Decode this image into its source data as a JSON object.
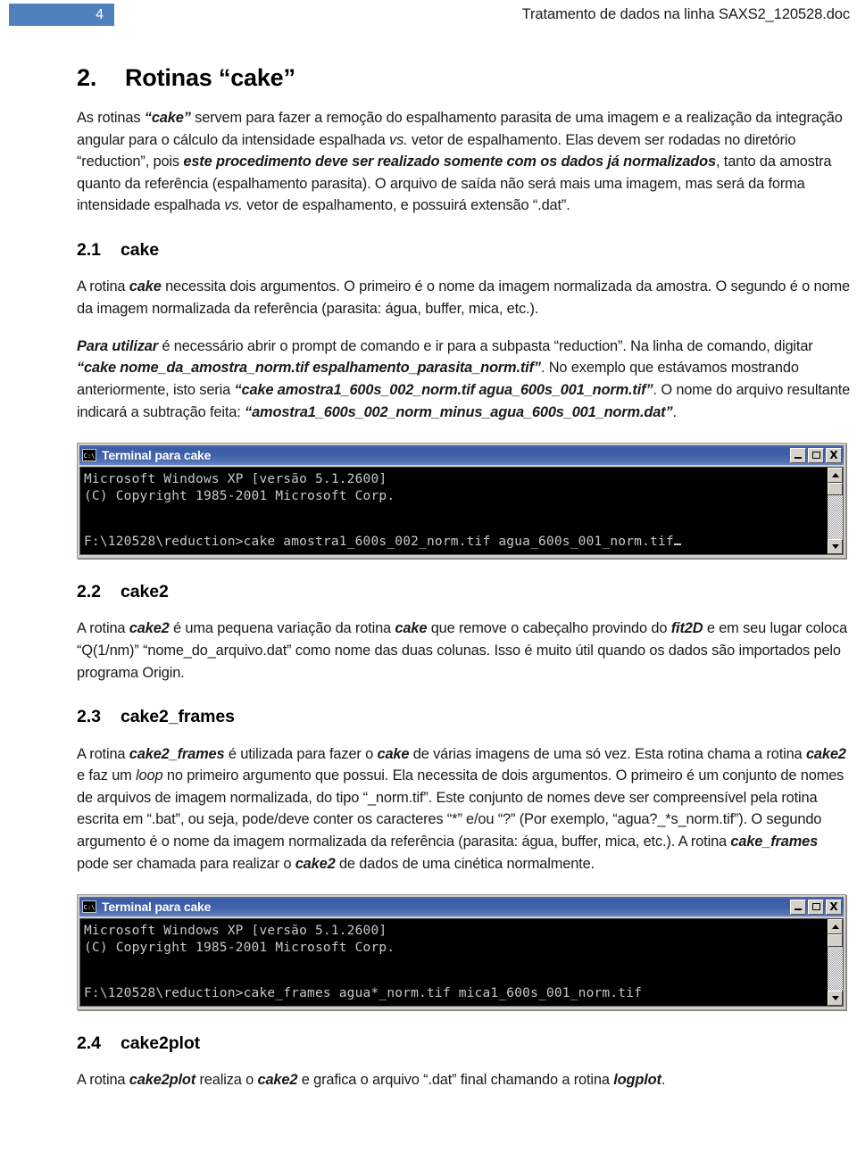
{
  "header": {
    "page_number": "4",
    "document_title": "Tratamento de dados na linha SAXS2_120528.doc",
    "badge_color": "#4f81bd"
  },
  "section": {
    "number": "2.",
    "title": "Rotinas “cake”",
    "intro_p1_a": "As rotinas ",
    "intro_p1_b": "“cake”",
    "intro_p1_c": " servem para fazer a remoção do espalhamento parasita de uma imagem e a realização da integração angular para o cálculo da intensidade espalhada ",
    "intro_p1_d": "vs.",
    "intro_p1_e": " vetor de espalhamento. Elas devem ser rodadas no diretório “reduction”, pois ",
    "intro_p1_f": "este procedimento deve ser realizado somente com os dados já normalizados",
    "intro_p1_g": ", tanto da amostra quanto da referência (espalhamento parasita). O arquivo de saída não será mais uma imagem, mas será da forma intensidade espalhada ",
    "intro_p1_h": "vs.",
    "intro_p1_i": " vetor de espalhamento, e possuirá extensão “.dat”."
  },
  "sub21": {
    "number": "2.1",
    "title": "cake",
    "p1_a": "A rotina ",
    "p1_b": "cake",
    "p1_c": " necessita dois argumentos. O primeiro é o nome da imagem normalizada da amostra. O segundo é o nome da imagem normalizada da referência (parasita: água, buffer, mica, etc.).",
    "p2_a": "Para utilizar",
    "p2_b": " é necessário abrir o prompt de comando e ir para a subpasta “reduction”. Na linha de comando, digitar ",
    "p2_c": "“cake nome_da_amostra_norm.tif espalhamento_parasita_norm.tif”",
    "p2_d": ". No exemplo que estávamos mostrando anteriormente, isto seria ",
    "p2_e": "“cake amostra1_600s_002_norm.tif agua_600s_001_norm.tif”",
    "p2_f": ". O nome do arquivo resultante indicará a subtração feita: ",
    "p2_g": "“amostra1_600s_002_norm_minus_agua_600s_001_norm.dat”",
    "p2_h": "."
  },
  "terminal1": {
    "title": "Terminal para cake",
    "icon": "console-icon",
    "icon_label": "C:\\",
    "minimize_label": "minimize",
    "maximize_label": "maximize",
    "close_label": "X",
    "line1": "Microsoft Windows XP [versão 5.1.2600]",
    "line2": "(C) Copyright 1985-2001 Microsoft Corp.",
    "line3": "F:\\120528\\reduction>cake amostra1_600s_002_norm.tif agua_600s_001_norm.tif"
  },
  "sub22": {
    "number": "2.2",
    "title": "cake2",
    "p1_a": "A rotina ",
    "p1_b": "cake2",
    "p1_c": " é uma pequena variação da rotina ",
    "p1_d": "cake",
    "p1_e": " que remove o cabeçalho provindo do ",
    "p1_f": "fit2D",
    "p1_g": " e em seu lugar coloca “Q(1/nm)” “nome_do_arquivo.dat” como nome das duas colunas. Isso é muito útil quando os dados são importados pelo programa Origin."
  },
  "sub23": {
    "number": "2.3",
    "title": "cake2_frames",
    "p1_a": "A rotina ",
    "p1_b": "cake2_frames",
    "p1_c": " é utilizada para fazer o ",
    "p1_d": "cake",
    "p1_e": " de várias imagens de uma só vez. Esta rotina chama a rotina  ",
    "p1_f": "cake2",
    "p1_g": " e faz um ",
    "p1_h": "loop",
    "p1_i": " no primeiro argumento que possui. Ela necessita de dois argumentos. O primeiro é um conjunto de nomes de arquivos de imagem normalizada, do tipo “_norm.tif”. Este conjunto de nomes deve ser compreensível pela rotina escrita em “.bat”, ou seja, pode/deve conter os caracteres “*” e/ou “?” (Por exemplo, “agua?_*s_norm.tif”). O segundo argumento é o nome da imagem normalizada da referência (parasita: água, buffer, mica, etc.). A rotina ",
    "p1_j": "cake_frames",
    "p1_k": " pode ser chamada para realizar o ",
    "p1_l": "cake2",
    "p1_m": " de dados de uma cinética normalmente."
  },
  "terminal2": {
    "title": "Terminal para cake",
    "icon": "console-icon",
    "icon_label": "C:\\",
    "minimize_label": "minimize",
    "maximize_label": "maximize",
    "close_label": "X",
    "line1": "Microsoft Windows XP [versão 5.1.2600]",
    "line2": "(C) Copyright 1985-2001 Microsoft Corp.",
    "line3": "F:\\120528\\reduction>cake_frames agua*_norm.tif mica1_600s_001_norm.tif"
  },
  "sub24": {
    "number": "2.4",
    "title": "cake2plot",
    "p1_a": "A rotina ",
    "p1_b": "cake2plot",
    "p1_c": " realiza o ",
    "p1_d": "cake2",
    "p1_e": " e grafica o arquivo “.dat” final chamando a rotina ",
    "p1_f": "logplot",
    "p1_g": "."
  }
}
